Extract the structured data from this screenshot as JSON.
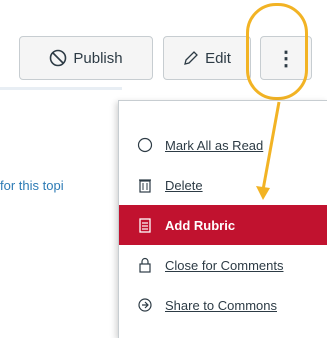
{
  "toolbar": {
    "publish_label": "Publish",
    "edit_label": "Edit",
    "more_label": "⋮"
  },
  "content": {
    "partial_text": "for this topi"
  },
  "menu": {
    "items": [
      {
        "label": "Mark All as Read",
        "icon": "circle-icon"
      },
      {
        "label": "Delete",
        "icon": "trash-icon"
      },
      {
        "label": "Add Rubric",
        "icon": "rubric-icon"
      },
      {
        "label": "Close for Comments",
        "icon": "lock-icon"
      },
      {
        "label": "Share to Commons",
        "icon": "share-icon"
      }
    ]
  },
  "colors": {
    "highlight": "#f2b324",
    "active_item": "#c1122f",
    "link_blue": "#2d7bb5"
  }
}
